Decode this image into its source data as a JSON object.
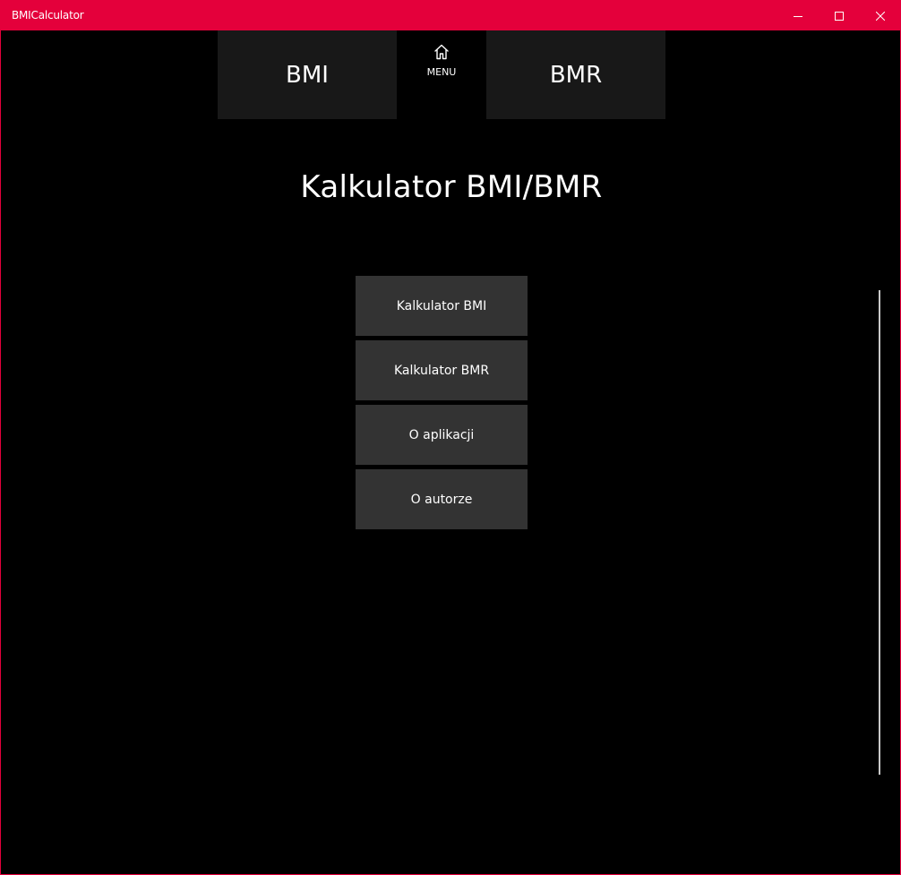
{
  "window": {
    "title": "BMICalculator",
    "accent_color": "#e4003b",
    "controls": {
      "minimize": "minimize-icon",
      "maximize": "maximize-icon",
      "close": "close-icon"
    }
  },
  "nav": {
    "bmi_label": "BMI",
    "menu_label": "MENU",
    "menu_icon": "home-icon",
    "bmr_label": "BMR"
  },
  "page": {
    "title": "Kalkulator BMI/BMR"
  },
  "menu": {
    "items": [
      {
        "label": "Kalkulator BMI"
      },
      {
        "label": "Kalkulator BMR"
      },
      {
        "label": "O aplikacji"
      },
      {
        "label": "O autorze"
      }
    ]
  },
  "colors": {
    "background": "#000000",
    "tile": "#181818",
    "button": "#333333",
    "text": "#ffffff"
  }
}
